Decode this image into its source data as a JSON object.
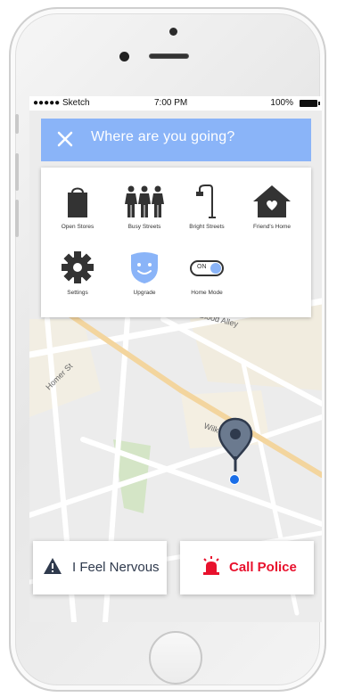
{
  "status_bar": {
    "carrier": "●●●●● Sketch",
    "time": "7:00 PM",
    "battery": "100%"
  },
  "search": {
    "close_icon": "close-icon",
    "placeholder": "Where are you going?"
  },
  "filters": [
    {
      "label": "Open Stores",
      "icon": "shopping-bag-icon"
    },
    {
      "label": "Busy Streets",
      "icon": "crowd-icon"
    },
    {
      "label": "Bright Streets",
      "icon": "street-lamp-icon"
    },
    {
      "label": "Friend's Home",
      "icon": "home-heart-icon"
    },
    {
      "label": "Settings",
      "icon": "gear-icon"
    },
    {
      "label": "Upgrade",
      "icon": "shield-smile-icon"
    },
    {
      "label": "Home Mode",
      "icon": "toggle-switch",
      "toggle_text": "ON"
    }
  ],
  "map": {
    "streets": [
      "Homer St",
      "Wilkes St",
      "Blood Alley"
    ]
  },
  "actions": {
    "nervous": {
      "label": "I Feel Nervous",
      "icon": "warning-icon"
    },
    "police": {
      "label": "Call Police",
      "icon": "siren-icon"
    }
  },
  "colors": {
    "accent": "#8ab4f8",
    "alert": "#e8112d",
    "pin": "#6b7a8f",
    "location_dot": "#1a6ee8"
  }
}
